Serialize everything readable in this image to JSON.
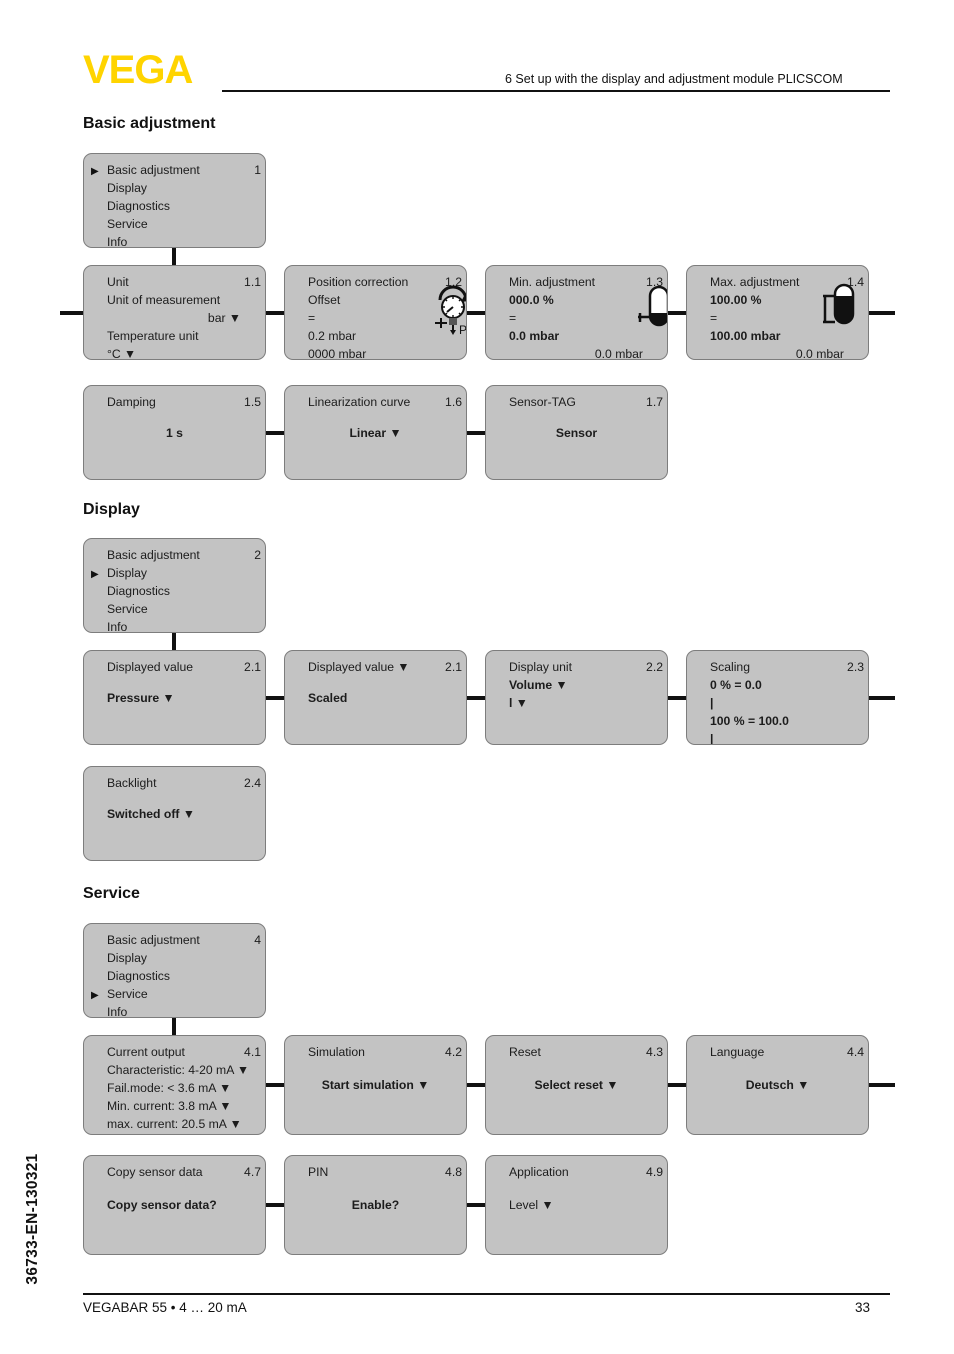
{
  "header": {
    "logo": "VEGA",
    "chapter_title": "6 Set up with the display and adjustment module PLICSCOM"
  },
  "footer": {
    "document_code": "36733-EN-130321",
    "left": "VEGABAR 55 • 4 … 20 mA",
    "page_number": "33"
  },
  "sections": [
    {
      "id": "basic-adjustment",
      "heading": "Basic adjustment",
      "menu": {
        "number": "1",
        "selected_index": 0,
        "items": [
          "Basic adjustment",
          "Display",
          "Diagnostics",
          "Service",
          "Info"
        ]
      },
      "boxes": [
        {
          "number": "1.1",
          "title": "Unit",
          "lines": [
            {
              "text": "Unit of measurement",
              "style": "left"
            },
            {
              "text": "bar ▼",
              "style": "right"
            },
            {
              "text": "Temperature unit",
              "style": "left"
            },
            {
              "text": "°C ▼",
              "style": "left"
            }
          ]
        },
        {
          "number": "1.2",
          "title": "Position correction",
          "icon": "pressure-gauge-icon",
          "lines": [
            {
              "text": "Offset",
              "style": "left"
            },
            {
              "text": "=",
              "style": "left"
            },
            {
              "text": "0.2 mbar",
              "style": "left"
            },
            {
              "text": "0000 mbar",
              "style": "left"
            }
          ]
        },
        {
          "number": "1.3",
          "title": "Min. adjustment",
          "icon": "tank-min-icon",
          "lines": [
            {
              "text": "000.0 %",
              "style": "left-bold"
            },
            {
              "text": "=",
              "style": "left"
            },
            {
              "text": "0.0 mbar",
              "style": "left-bold"
            },
            {
              "text": "0.0 mbar",
              "style": "right"
            }
          ]
        },
        {
          "number": "1.4",
          "title": "Max. adjustment",
          "icon": "tank-max-icon",
          "lines": [
            {
              "text": "100.00 %",
              "style": "left-bold"
            },
            {
              "text": "=",
              "style": "left"
            },
            {
              "text": "100.00 mbar",
              "style": "left-bold"
            },
            {
              "text": "0.0 mbar",
              "style": "right"
            }
          ]
        },
        {
          "number": "1.5",
          "title": "Damping",
          "lines": [
            {
              "text": "1 s",
              "style": "center-bold"
            }
          ]
        },
        {
          "number": "1.6",
          "title": "Linearization curve",
          "lines": [
            {
              "text": "Linear ▼",
              "style": "center-bold"
            }
          ]
        },
        {
          "number": "1.7",
          "title": "Sensor-TAG",
          "lines": [
            {
              "text": "Sensor",
              "style": "center-bold"
            }
          ]
        }
      ]
    },
    {
      "id": "display",
      "heading": "Display",
      "menu": {
        "number": "2",
        "selected_index": 1,
        "items": [
          "Basic adjustment",
          "Display",
          "Diagnostics",
          "Service",
          "Info"
        ]
      },
      "boxes": [
        {
          "number": "2.1",
          "title": "Displayed value",
          "lines": [
            {
              "text": "Pressure ▼",
              "style": "left-bold"
            }
          ]
        },
        {
          "number": "2.1",
          "title": "Displayed value ▼",
          "lines": [
            {
              "text": "Scaled",
              "style": "left-bold"
            }
          ]
        },
        {
          "number": "2.2",
          "title": "Display unit",
          "lines": [
            {
              "text": "Volume ▼",
              "style": "left-bold"
            },
            {
              "text": "l ▼",
              "style": "left-bold"
            }
          ]
        },
        {
          "number": "2.3",
          "title": "Scaling",
          "lines": [
            {
              "text": "0 % = 0.0",
              "style": "left-bold"
            },
            {
              "text": "|",
              "style": "left-bold"
            },
            {
              "text": "100 % = 100.0",
              "style": "left-bold"
            },
            {
              "text": "|",
              "style": "left-bold"
            }
          ]
        },
        {
          "number": "2.4",
          "title": "Backlight",
          "lines": [
            {
              "text": "Switched off ▼",
              "style": "left-bold"
            }
          ]
        }
      ]
    },
    {
      "id": "service",
      "heading": "Service",
      "menu": {
        "number": "4",
        "selected_index": 3,
        "items": [
          "Basic adjustment",
          "Display",
          "Diagnostics",
          "Service",
          "Info"
        ]
      },
      "boxes": [
        {
          "number": "4.1",
          "title": "Current output",
          "lines": [
            {
              "text": "Characteristic: 4-20 mA ▼",
              "style": "left"
            },
            {
              "text": "Fail.mode: < 3.6 mA ▼",
              "style": "left"
            },
            {
              "text": "Min. current: 3.8 mA ▼",
              "style": "left"
            },
            {
              "text": "max. current: 20.5 mA ▼",
              "style": "left"
            }
          ]
        },
        {
          "number": "4.2",
          "title": "Simulation",
          "lines": [
            {
              "text": "Start simulation ▼",
              "style": "center-bold"
            }
          ]
        },
        {
          "number": "4.3",
          "title": "Reset",
          "lines": [
            {
              "text": "Select reset ▼",
              "style": "center-bold"
            }
          ]
        },
        {
          "number": "4.4",
          "title": "Language",
          "lines": [
            {
              "text": "Deutsch ▼",
              "style": "center-bold"
            }
          ]
        },
        {
          "number": "4.7",
          "title": "Copy sensor data",
          "lines": [
            {
              "text": "Copy sensor data?",
              "style": "left-bold"
            }
          ]
        },
        {
          "number": "4.8",
          "title": "PIN",
          "lines": [
            {
              "text": "Enable?",
              "style": "center-bold"
            }
          ]
        },
        {
          "number": "4.9",
          "title": "Application",
          "lines": [
            {
              "text": "Level ▼",
              "style": "left"
            }
          ]
        }
      ]
    }
  ]
}
